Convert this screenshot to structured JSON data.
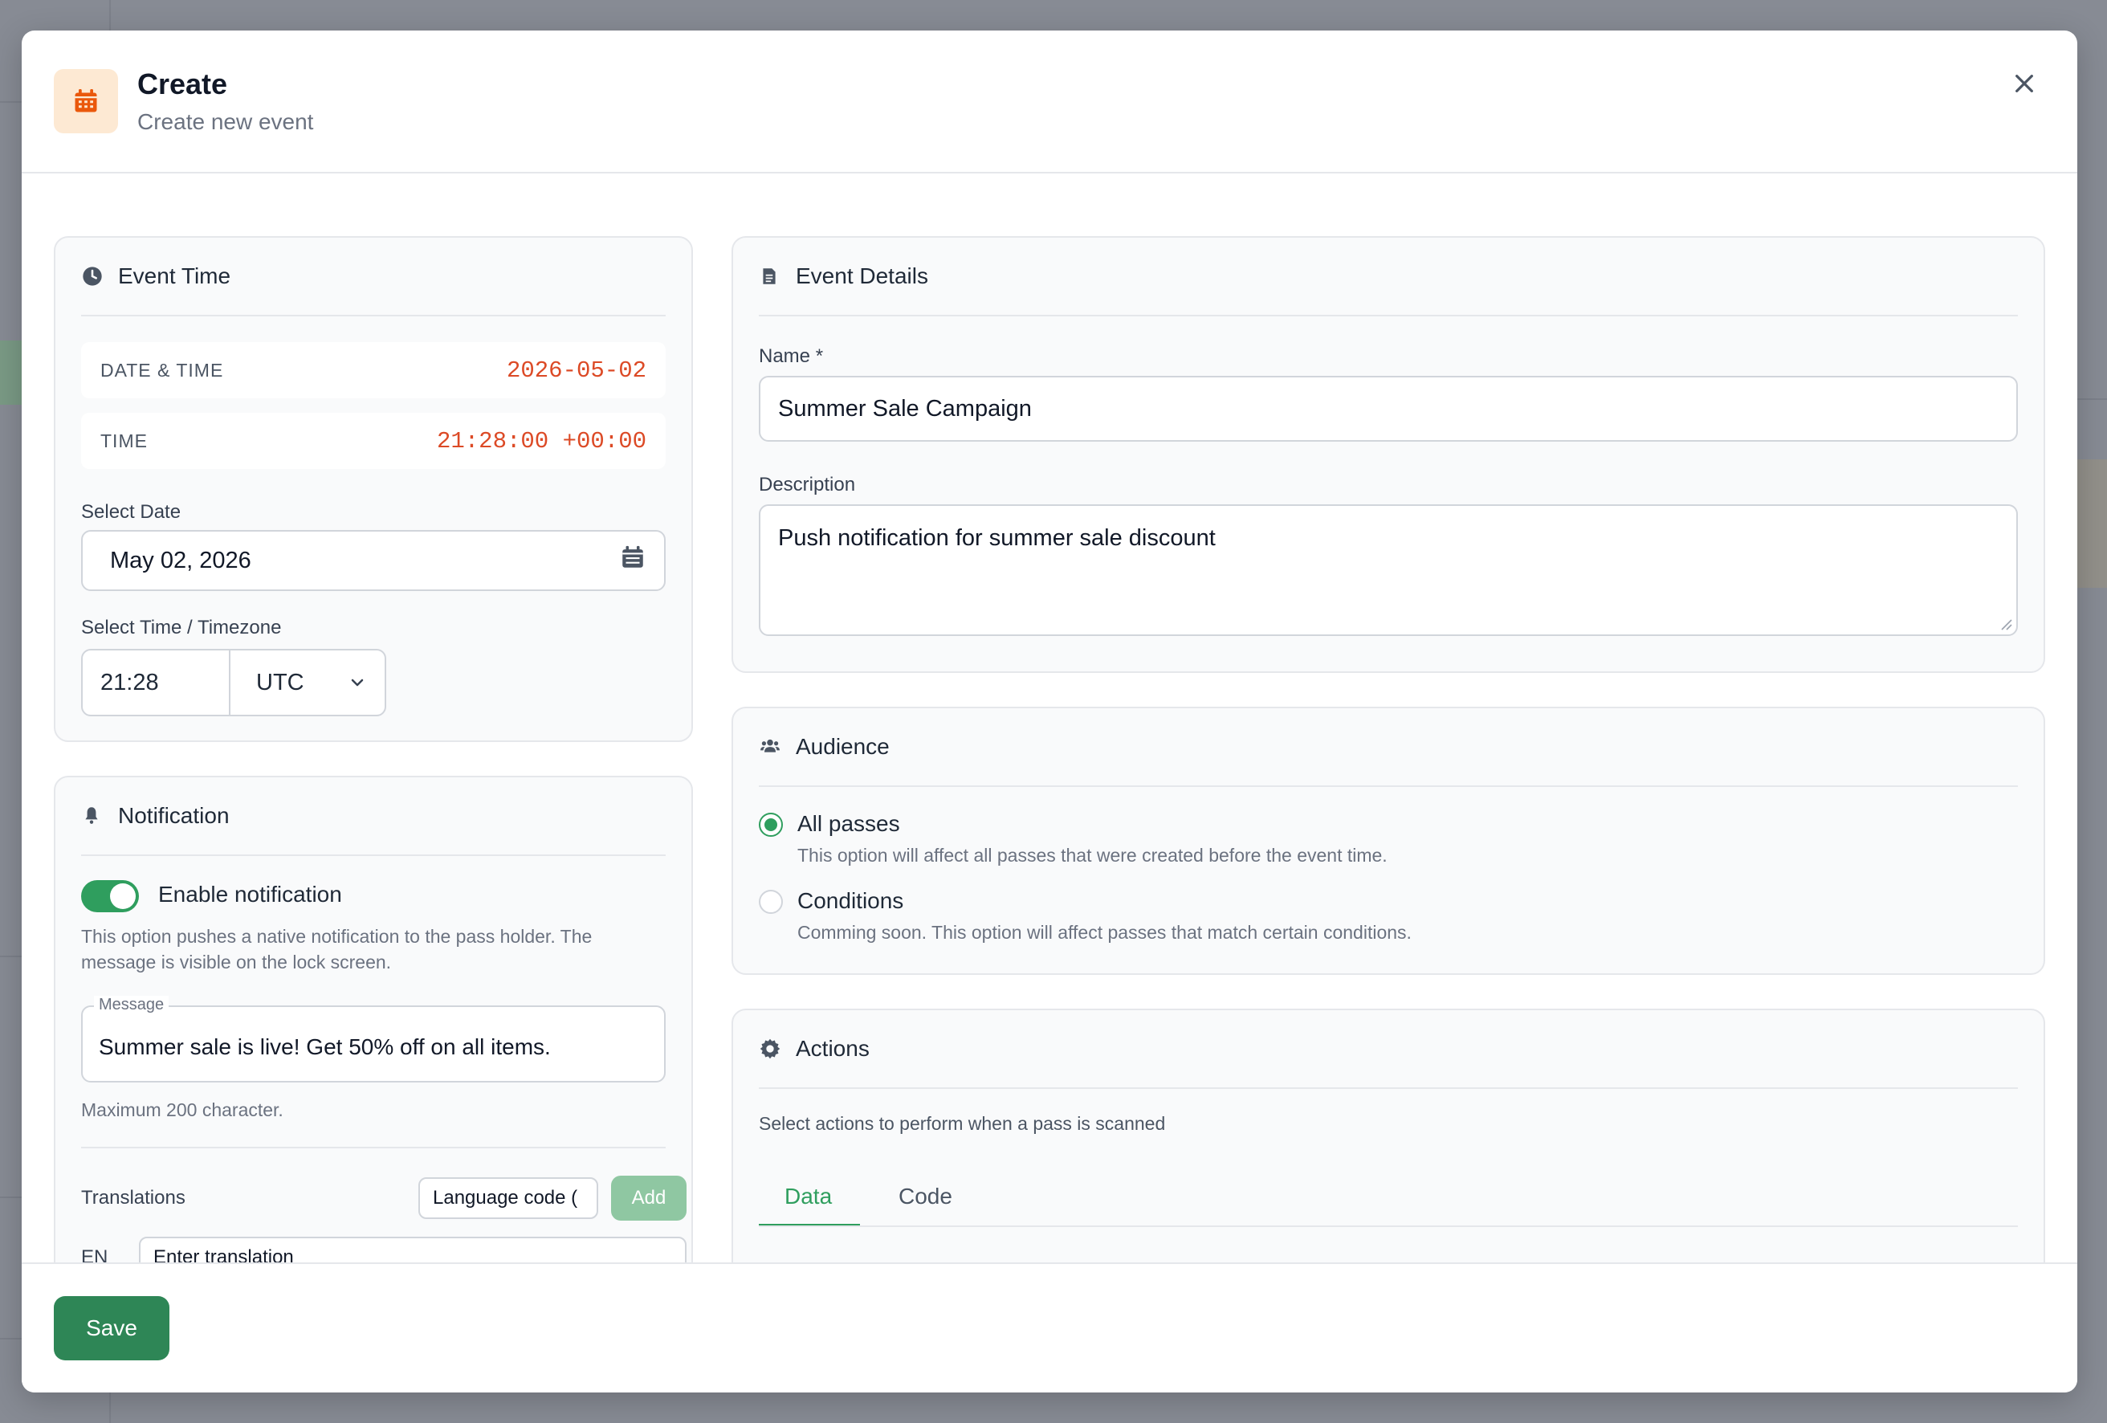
{
  "header": {
    "title": "Create",
    "subtitle": "Create new event"
  },
  "event_time": {
    "title": "Event Time",
    "date_time_label": "DATE & TIME",
    "date_time_value": "2026-05-02",
    "time_label": "TIME",
    "time_value": "21:28:00 +00:00",
    "select_date_label": "Select Date",
    "date_input_value": "May 02, 2026",
    "select_time_label": "Select Time / Timezone",
    "time_input_value": "21:28",
    "timezone_value": "UTC"
  },
  "notification": {
    "title": "Notification",
    "toggle_label": "Enable notification",
    "toggle_on": true,
    "helper_line1": "This option pushes a native notification to the pass holder. The",
    "helper_line2": "message is visible on the lock screen.",
    "message_legend": "Message",
    "message_value": "Summer sale is live! Get 50% off on all items.",
    "max_helper": "Maximum 200 character.",
    "translations_label": "Translations",
    "language_code_placeholder": "Language code (",
    "add_label": "Add",
    "translation_lang": "EN",
    "translation_placeholder": "Enter translation"
  },
  "event_details": {
    "title": "Event Details",
    "name_label": "Name *",
    "name_value": "Summer Sale Campaign",
    "description_label": "Description",
    "description_value": "Push notification for summer sale discount"
  },
  "audience": {
    "title": "Audience",
    "options": [
      {
        "title": "All passes",
        "desc": "This option will affect all passes that were created before the event time.",
        "selected": true
      },
      {
        "title": "Conditions",
        "desc": "Comming soon. This option will affect passes that match certain conditions.",
        "selected": false
      }
    ]
  },
  "actions": {
    "title": "Actions",
    "helper": "Select actions to perform when a pass is scanned",
    "tabs": [
      "Data",
      "Code"
    ]
  },
  "footer": {
    "save_label": "Save"
  },
  "colors": {
    "accent_green": "#2f9e5e",
    "save_green": "#2e8656",
    "mono_orange": "#dc4a26",
    "header_icon_bg": "#fde9d3"
  }
}
